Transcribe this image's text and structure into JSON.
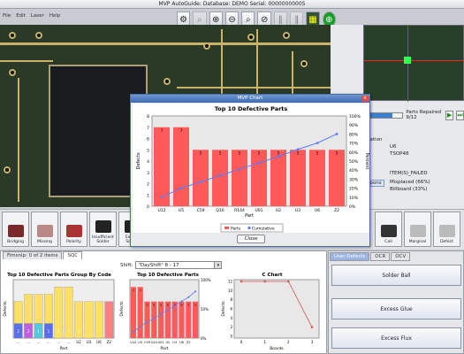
{
  "window": {
    "title": "MVP AutoGuide: Database: DEMO Serial: 00000000005"
  },
  "menu": [
    "File",
    "Edit",
    "Laser",
    "Help"
  ],
  "toolbar": [
    "inspect",
    "lens",
    "zoom-in",
    "zoom-out",
    "search",
    "zoom-out-2",
    "pause",
    "pause-2",
    "pcb",
    "target"
  ],
  "progress": {
    "label": "Parts Repaired 9/12",
    "fraction": 0.75
  },
  "info": {
    "header": "rmation",
    "part": "U6",
    "package": "TSOP48",
    "status": "ITEM(S)_FAILED",
    "tab": "ispons",
    "defect1": "Misplaced (66%)",
    "defect2": "Billboard (33%)"
  },
  "defect_buttons": [
    "Bridging",
    "Missing",
    "Polarity",
    "Insufficient Solder",
    "Excess Solder",
    "Call",
    "Marginal",
    "Defect"
  ],
  "bottom_tabs": [
    "Fimsnip: 0 of 2 items",
    "SQC"
  ],
  "shift": {
    "label": "Shift:",
    "value": "\"DayShift\"  8 -  17"
  },
  "side_tabs": [
    "User Defects",
    "OCR",
    "OCV"
  ],
  "side_buttons": [
    "Solder Ball",
    "Excess Glue",
    "Excess Flux"
  ],
  "dialog": {
    "title": "MVP Chart",
    "close_label": "Close"
  },
  "chart_data": [
    {
      "type": "bar",
      "title": "Top 10 Defective Parts",
      "xlabel": "Part",
      "ylabel": "Defects",
      "y2label": "Percent",
      "categories": [
        "U12",
        "U5",
        "C59",
        "Q10",
        "R144",
        "U01",
        "U2",
        "U3",
        "U6",
        "Z2"
      ],
      "series": [
        {
          "name": "Parts",
          "values": [
            7,
            7,
            5,
            5,
            5,
            5,
            5,
            5,
            5,
            5
          ],
          "color": "#ff5a5a"
        },
        {
          "name": "Cumulative",
          "values": [
            10,
            20,
            27,
            34,
            41,
            48,
            55,
            63,
            70,
            80
          ],
          "color": "#5a7bff"
        }
      ],
      "ylim": [
        0,
        8
      ],
      "y2ticks": [
        "0%",
        "10%",
        "20%",
        "30%",
        "40%",
        "50%",
        "60%",
        "70%",
        "80%",
        "90%",
        "100%"
      ],
      "legend": "bottom"
    },
    {
      "type": "bar",
      "title": "Top 10 Defective Parts Group By Code",
      "xlabel": "Part",
      "ylabel": "Defects",
      "categories": [
        "...",
        "...",
        "...",
        "...",
        "...",
        "...",
        "U2",
        "U3",
        "U6",
        "Z2"
      ],
      "stack_labels": [
        "2",
        "2",
        "1",
        "1",
        "2",
        "1",
        "1"
      ],
      "ylim": [
        0,
        8
      ]
    },
    {
      "type": "bar",
      "title": "Top 10 Defective Parts",
      "xlabel": "Part",
      "ylabel": "Defects",
      "categories": [
        "U12",
        "U5",
        "C59",
        "Q10",
        "",
        "",
        "U01",
        "U2",
        "U3",
        "U6",
        "Z2"
      ],
      "values": [
        7,
        7,
        5,
        5,
        5,
        5,
        5,
        5,
        5,
        5
      ],
      "cumulative": [
        10,
        20,
        27,
        34,
        41,
        48,
        55,
        63,
        70,
        80
      ],
      "y2ticks": [
        "0%",
        "50%",
        "100%"
      ]
    },
    {
      "type": "line",
      "title": "C Chart",
      "xlabel": "Boards",
      "ylabel": "Defects",
      "x": [
        0,
        1,
        2,
        3
      ],
      "values": [
        12,
        12,
        12,
        2
      ],
      "yticks": [
        0,
        2,
        4,
        6,
        8,
        10,
        12
      ],
      "color": "#e05050"
    }
  ]
}
